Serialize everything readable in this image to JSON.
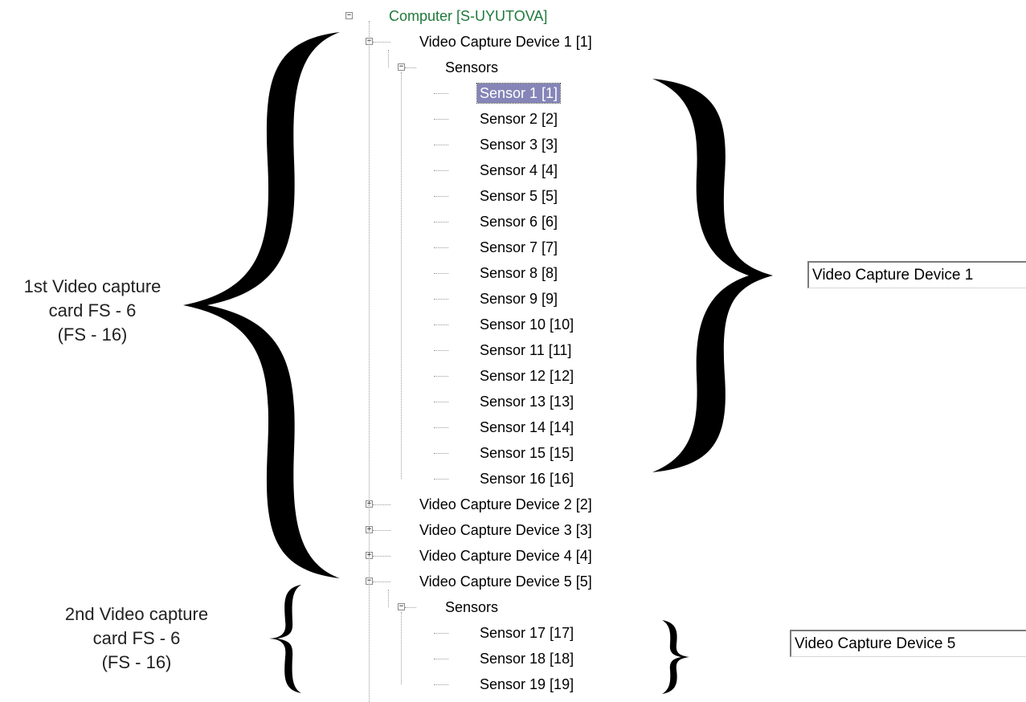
{
  "tree": {
    "root": {
      "label": "Computer [S-UYUTOVA]",
      "icon": "computer-icon",
      "expanded": true
    },
    "devices": [
      {
        "label": "Video Capture Device 1 [1]",
        "expanded": true,
        "sensors_label": "Sensors",
        "sensors": [
          "Sensor 1 [1]",
          "Sensor 2 [2]",
          "Sensor 3 [3]",
          "Sensor 4 [4]",
          "Sensor 5 [5]",
          "Sensor 6 [6]",
          "Sensor 7 [7]",
          "Sensor 8 [8]",
          "Sensor 9 [9]",
          "Sensor 10 [10]",
          "Sensor 11 [11]",
          "Sensor 12 [12]",
          "Sensor 13 [13]",
          "Sensor 14 [14]",
          "Sensor 15 [15]",
          "Sensor 16 [16]"
        ],
        "selected_index": 0
      },
      {
        "label": "Video Capture Device 2 [2]",
        "expanded": false
      },
      {
        "label": "Video Capture Device 3 [3]",
        "expanded": false
      },
      {
        "label": "Video Capture Device 4 [4]",
        "expanded": false
      },
      {
        "label": "Video Capture Device 5 [5]",
        "expanded": true,
        "sensors_label": "Sensors",
        "sensors": [
          "Sensor 17 [17]",
          "Sensor 18 [18]",
          "Sensor 19 [19]"
        ]
      }
    ]
  },
  "annotations": {
    "card1": [
      "1st Video capture",
      "card FS - 6",
      "(FS - 16)"
    ],
    "card2": [
      "2nd Video capture",
      "card FS - 6",
      "(FS - 16)"
    ]
  },
  "fields": {
    "device1": "Video Capture Device 1",
    "device5": "Video Capture Device 5"
  },
  "icons": {
    "computer": "computer-icon",
    "device": "capture-board-icon",
    "sensor": "sensor-signal-icon"
  },
  "colors": {
    "selection": "#8585b8",
    "root_text": "#1f7a3a",
    "sensor_red": "#d22020"
  }
}
